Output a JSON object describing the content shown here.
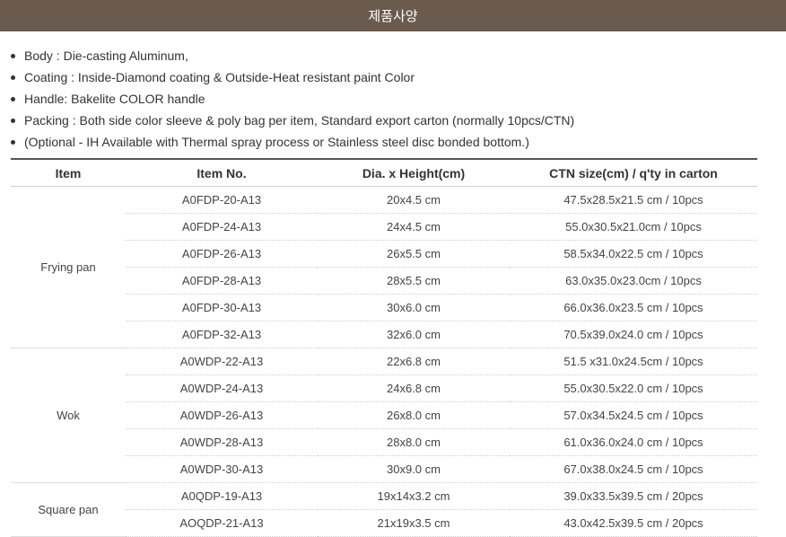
{
  "header": {
    "title": "제품사양"
  },
  "specs": [
    "Body : Die-casting Aluminum,",
    "Coating : Inside-Diamond coating & Outside-Heat resistant paint Color",
    "Handle: Bakelite COLOR handle",
    "Packing : Both side color sleeve & poly bag per item, Standard export carton (normally 10pcs/CTN)",
    "(Optional - IH Available with Thermal spray process or Stainless steel disc bonded bottom.)"
  ],
  "table": {
    "headers": [
      "Item",
      "Item No.",
      "Dia. x Height(cm)",
      "CTN size(cm) / q'ty in carton"
    ],
    "groups": [
      {
        "item": "Frying pan",
        "rows": [
          [
            "A0FDP-20-A13",
            "20x4.5 cm",
            "47.5x28.5x21.5 cm / 10pcs"
          ],
          [
            "A0FDP-24-A13",
            "24x4.5 cm",
            "55.0x30.5x21.0cm / 10pcs"
          ],
          [
            "A0FDP-26-A13",
            "26x5.5 cm",
            "58.5x34.0x22.5 cm / 10pcs"
          ],
          [
            "A0FDP-28-A13",
            "28x5.5 cm",
            "63.0x35.0x23.0cm / 10pcs"
          ],
          [
            "A0FDP-30-A13",
            "30x6.0 cm",
            "66.0x36.0x23.5 cm / 10pcs"
          ],
          [
            "A0FDP-32-A13",
            "32x6.0 cm",
            "70.5x39.0x24.0 cm / 10pcs"
          ]
        ]
      },
      {
        "item": "Wok",
        "rows": [
          [
            "A0WDP-22-A13",
            "22x6.8 cm",
            "51.5 x31.0x24.5cm / 10pcs"
          ],
          [
            "A0WDP-24-A13",
            "24x6.8 cm",
            "55.0x30.5x22.0 cm / 10pcs"
          ],
          [
            "A0WDP-26-A13",
            "26x8.0 cm",
            "57.0x34.5x24.5 cm / 10pcs"
          ],
          [
            "A0WDP-28-A13",
            "28x8.0 cm",
            "61.0x36.0x24.0 cm / 10pcs"
          ],
          [
            "A0WDP-30-A13",
            "30x9.0 cm",
            "67.0x38.0x24.5 cm / 10pcs"
          ]
        ]
      },
      {
        "item": "Square pan",
        "rows": [
          [
            "A0QDP-19-A13",
            "19x14x3.2 cm",
            "39.0x33.5x39.5 cm / 20pcs"
          ],
          [
            "AOQDP-21-A13",
            "21x19x3.5 cm",
            "43.0x42.5x39.5 cm / 20pcs"
          ]
        ]
      }
    ]
  }
}
